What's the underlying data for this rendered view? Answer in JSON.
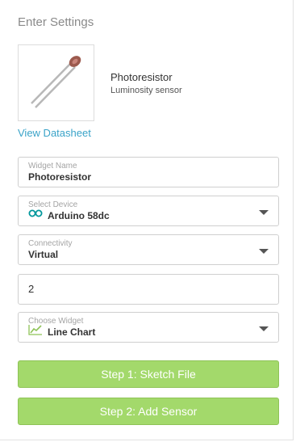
{
  "panel": {
    "title": "Enter Settings"
  },
  "sensor": {
    "name": "Photoresistor",
    "description": "Luminosity sensor",
    "datasheet_link": "View Datasheet"
  },
  "fields": {
    "widget_name": {
      "label": "Widget Name",
      "value": "Photoresistor"
    },
    "device": {
      "label": "Select Device",
      "value": "Arduino 58dc",
      "icon": "arduino-icon"
    },
    "connectivity": {
      "label": "Connectivity",
      "value": "Virtual"
    },
    "pin": {
      "value": "2"
    },
    "widget": {
      "label": "Choose Widget",
      "value": "Line Chart",
      "icon": "line-chart-icon"
    }
  },
  "buttons": {
    "step1": "Step 1: Sketch File",
    "step2": "Step 2: Add Sensor"
  },
  "colors": {
    "accent_green": "#a3d96b",
    "link_blue": "#3aa3c8",
    "arduino_teal": "#00979c"
  }
}
